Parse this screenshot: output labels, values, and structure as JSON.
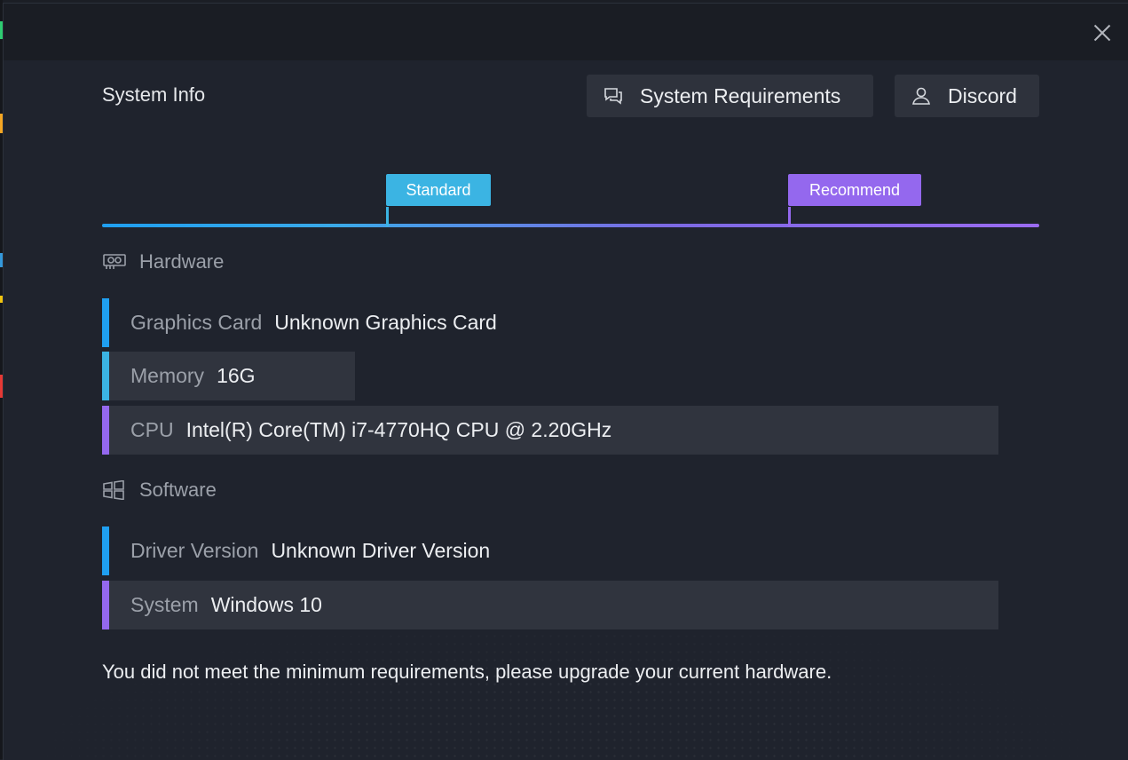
{
  "title": "System Info",
  "buttons": {
    "system_requirements": "System Requirements",
    "discord": "Discord"
  },
  "tiers": {
    "standard": "Standard",
    "recommend": "Recommend"
  },
  "hardware": {
    "heading": "Hardware",
    "rows": [
      {
        "label": "Graphics Card",
        "value": "Unknown Graphics Card",
        "tier": "below-standard"
      },
      {
        "label": "Memory",
        "value": "16G",
        "tier": "standard"
      },
      {
        "label": "CPU",
        "value": "Intel(R) Core(TM) i7-4770HQ CPU @ 2.20GHz",
        "tier": "recommend"
      }
    ]
  },
  "software": {
    "heading": "Software",
    "rows": [
      {
        "label": "Driver Version",
        "value": "Unknown Driver Version",
        "tier": "below-standard"
      },
      {
        "label": "System",
        "value": "Windows 10",
        "tier": "recommend"
      }
    ]
  },
  "message": "You did not meet the minimum requirements, please upgrade your current hardware.",
  "colors": {
    "accent_blue": "#1f9ff0",
    "accent_cyan": "#3bb4e3",
    "accent_purple": "#9468ee",
    "background": "#1f232d",
    "row_bg": "#30343e"
  },
  "icons": {
    "close": "close-icon",
    "system_requirements": "chat-bubbles-icon",
    "discord": "user-icon",
    "hardware": "graphics-card-icon",
    "software": "windows-icon"
  }
}
